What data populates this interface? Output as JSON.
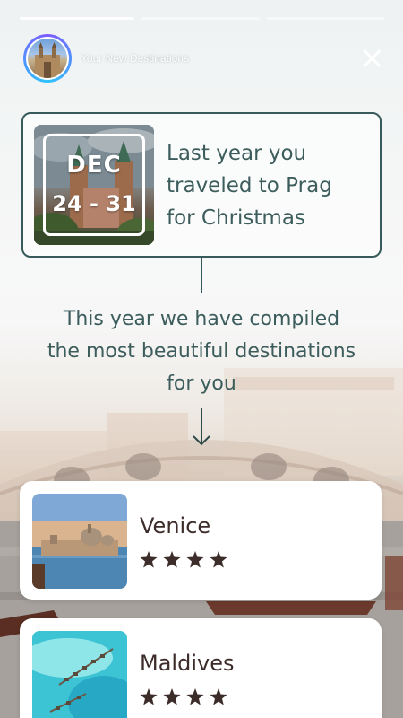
{
  "header": {
    "title": "Your New Destinations",
    "progress_segments": 3,
    "active_segment": 1
  },
  "last_year": {
    "month": "DEC",
    "days": "24 - 31",
    "text_lines": [
      "Last year you",
      "traveled to Prag",
      "for Christmas"
    ]
  },
  "compiled": {
    "lines": [
      "This year we have compiled",
      "the most beautiful destinations",
      "for you"
    ]
  },
  "destinations": [
    {
      "name": "Venice",
      "stars": 4
    },
    {
      "name": "Maldives",
      "stars": 4
    }
  ],
  "colors": {
    "accent_teal": "#375b5b",
    "text_teal": "#3c5d5c",
    "dest_text": "#3d2d2a"
  },
  "icons": {
    "close": "close-icon",
    "arrow": "arrow-down-icon",
    "star": "star-icon"
  }
}
